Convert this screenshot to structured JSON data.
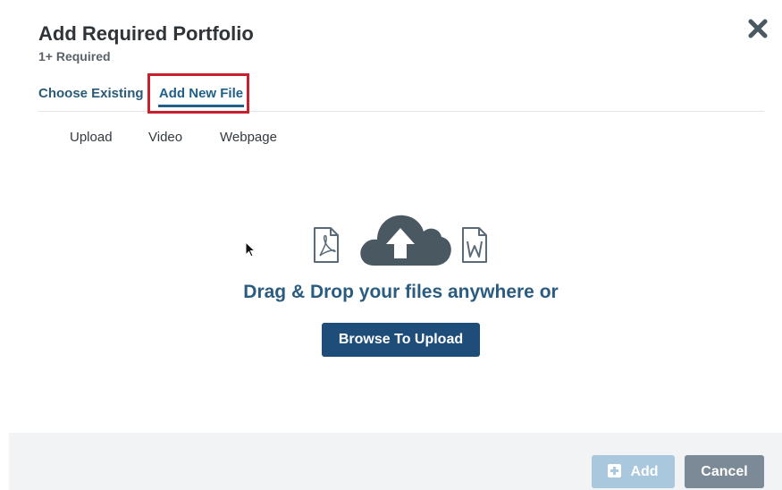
{
  "modal": {
    "title": "Add Required Portfolio",
    "subtitle": "1+ Required"
  },
  "tabs": [
    {
      "label": "Choose Existing",
      "active": false
    },
    {
      "label": "Add New File",
      "active": true
    }
  ],
  "subtabs": [
    {
      "label": "Upload"
    },
    {
      "label": "Video"
    },
    {
      "label": "Webpage"
    }
  ],
  "dropzone": {
    "message": "Drag & Drop your files anywhere or",
    "browse_label": "Browse To Upload",
    "icons": [
      "pdf-file-icon",
      "cloud-upload-icon",
      "word-file-icon"
    ]
  },
  "footer": {
    "add_label": "Add",
    "cancel_label": "Cancel"
  },
  "colors": {
    "accent": "#1f4d7a",
    "tab_active": "#1f5f8a",
    "highlight": "#c8202d",
    "add_disabled": "#a9c7dd",
    "cancel": "#7b8a96",
    "icon_gray": "#4a5862"
  }
}
